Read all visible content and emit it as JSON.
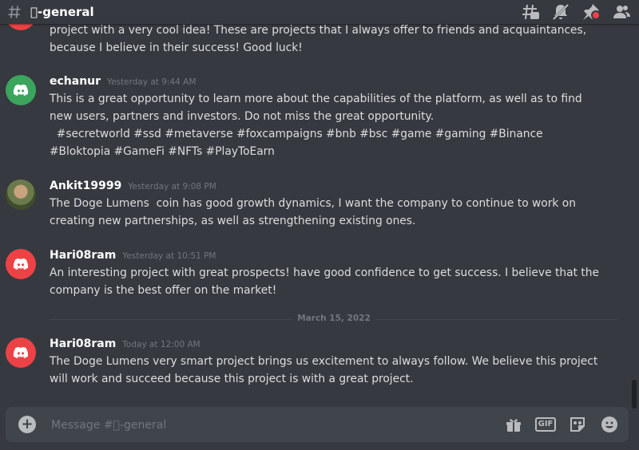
{
  "header": {
    "channel_name": "\u0000-general"
  },
  "messages": [
    {
      "author": "",
      "timestamp": "",
      "text": "project with a very cool idea! These are projects that I always offer to friends and acquaintances, because I believe in their success! Good luck!"
    },
    {
      "author": "echanur",
      "timestamp": "Yesterday at 9:44 AM",
      "text": "This is a great opportunity to learn more about the capabilities of the platform, as well as to find new users, partners and investors. Do not miss the great opportunity.\n  #secretworld #ssd #metaverse #foxcampaigns #bnb #bsc #game #gaming #Binance #Bloktopia #GameFi #NFTs #PlayToEarn"
    },
    {
      "author": "Ankit19999",
      "timestamp": "Yesterday at 9:08 PM",
      "text": "The Doge Lumens  coin has good growth dynamics, I want the company to continue to work on creating new partnerships, as well as strengthening existing ones."
    },
    {
      "author": "Hari08ram",
      "timestamp": "Yesterday at 10:51 PM",
      "text": "An interesting project with great prospects! have good confidence to get success. I believe that the company is the best offer on the market!"
    },
    {
      "author": "Hari08ram",
      "timestamp": "Today at 12:00 AM",
      "text": "The Doge Lumens very smart project brings us excitement to always follow. We believe this project will work and succeed because this project is with a great project."
    }
  ],
  "date_divider": "March 15, 2022",
  "composer": {
    "placeholder": "Message #\u0000-general",
    "gif_label": "GIF"
  },
  "icons": [
    "threads-icon",
    "mute-icon",
    "pin-icon",
    "members-icon",
    "gift-icon",
    "gif-icon",
    "sticker-icon",
    "emoji-icon"
  ],
  "colors": {
    "background": "#36393f",
    "composer": "#40444b",
    "discord_green": "#3ba55d",
    "discord_red": "#ed4245"
  }
}
